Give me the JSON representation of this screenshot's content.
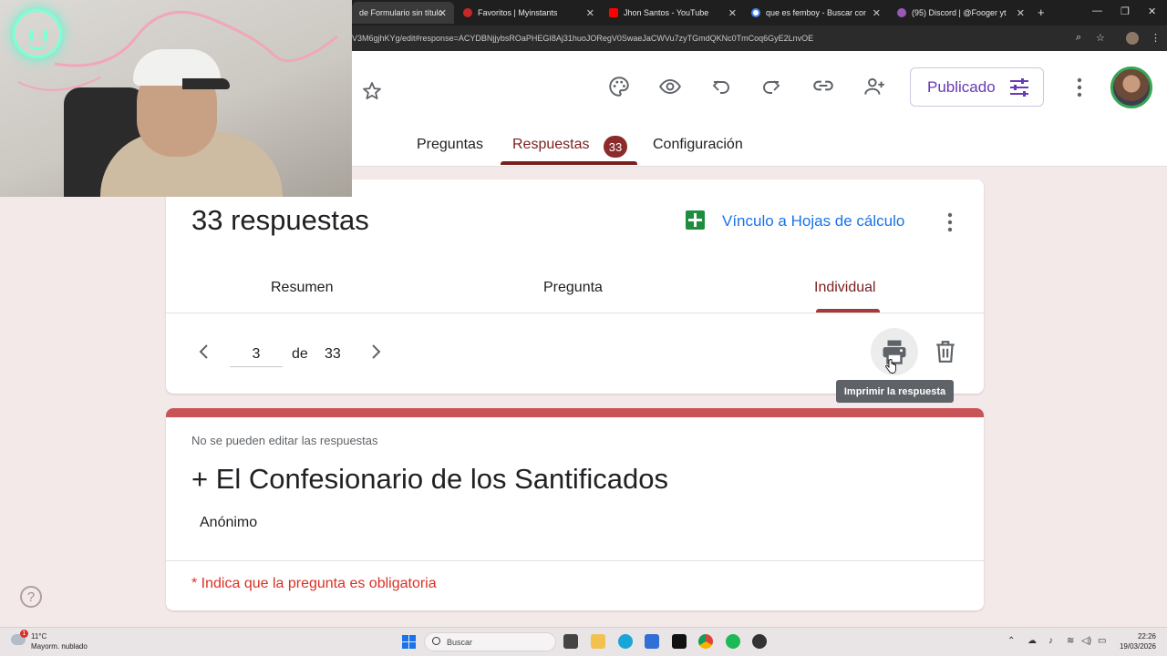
{
  "browser": {
    "tabs": [
      {
        "title": "de Formulario sin título",
        "active": true,
        "favicon_color": "#7248b9"
      },
      {
        "title": "Favoritos | Myinstants",
        "active": false,
        "favicon_color": "#c62828"
      },
      {
        "title": "Jhon Santos - YouTube",
        "active": false,
        "favicon_color": "#ff0000"
      },
      {
        "title": "que es femboy - Buscar con Go",
        "active": false,
        "favicon_color": "#ffffff"
      },
      {
        "title": "(95) Discord | @Fooger yt",
        "active": false,
        "favicon_color": "#9b59b6"
      }
    ],
    "url": "V3M6gjhKYg/edit#response=ACYDBNjjybsROaPHEGI8Aj31huoJORegV0SwaeJaCWVu7zyTGmdQKNc0TmCoq6GyE2LnvOE"
  },
  "header": {
    "publish_label": "Publicado",
    "tabs": {
      "preguntas": "Preguntas",
      "respuestas": "Respuestas",
      "respuestas_count": "33",
      "configuracion": "Configuración"
    },
    "accent_color": "#7a1f1f"
  },
  "responses": {
    "title": "33 respuestas",
    "sheets_link": "Vínculo a Hojas de cálculo",
    "subtabs": {
      "resumen": "Resumen",
      "pregunta": "Pregunta",
      "individual": "Individual"
    },
    "pager": {
      "current": "3",
      "of_label": "de",
      "total": "33"
    },
    "tooltip": "Imprimir la respuesta"
  },
  "form_preview": {
    "notice": "No se pueden editar las respuestas",
    "title": "+  El Confesionario de los Santificados",
    "subtitle": "Anónimo",
    "required_note": "* Indica que la pregunta es obligatoria",
    "theme_color": "#c85456"
  },
  "help": {
    "label": "?"
  },
  "taskbar": {
    "weather_temp": "11°C",
    "weather_desc": "Mayorm. nublado",
    "weather_badge": "1",
    "search_placeholder": "Buscar",
    "time": "22:26",
    "date": "19/03/2026"
  }
}
